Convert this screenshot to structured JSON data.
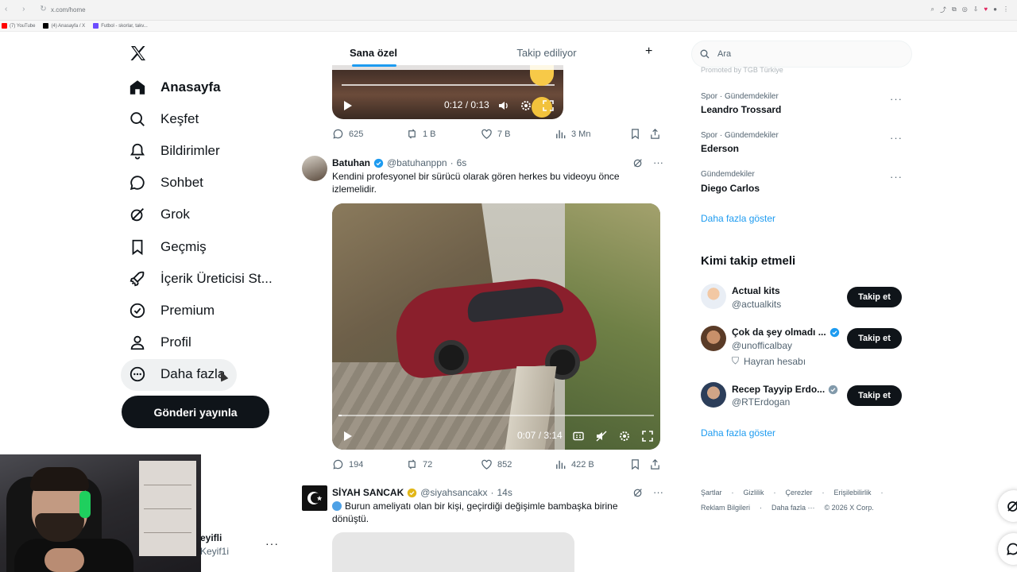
{
  "browser": {
    "url": "x.com/home",
    "bookmarks": [
      "(7) YouTube",
      "(4) Anasayfa / X",
      "Futbol - skorlar, takv..."
    ]
  },
  "sidebar": {
    "items": [
      {
        "label": "Anasayfa",
        "icon": "home-icon",
        "active": true
      },
      {
        "label": "Keşfet",
        "icon": "search-icon"
      },
      {
        "label": "Bildirimler",
        "icon": "bell-icon"
      },
      {
        "label": "Sohbet",
        "icon": "chat-icon"
      },
      {
        "label": "Grok",
        "icon": "grok-icon"
      },
      {
        "label": "Geçmiş",
        "icon": "bookmark-icon"
      },
      {
        "label": "İçerik Üreticisi St...",
        "icon": "rocket-icon"
      },
      {
        "label": "Premium",
        "icon": "verified-badge-icon"
      },
      {
        "label": "Profil",
        "icon": "person-icon"
      },
      {
        "label": "Daha fazla",
        "icon": "more-circle-icon"
      }
    ],
    "post_button": "Gönderi yayınla",
    "account": {
      "name": "eyifli",
      "handle": "Keyif1i"
    }
  },
  "timeline": {
    "tabs": [
      "Sana özel",
      "Takip ediliyor"
    ],
    "first_video": {
      "time": "0:12 / 0:13"
    },
    "first_actions": {
      "replies": "625",
      "reposts": "1 B",
      "likes": "7 B",
      "views": "3 Mn"
    },
    "tweet2": {
      "name": "Batuhan",
      "handle": "@batuhanppn",
      "time": "6s",
      "text": "Kendini profesyonel bir sürücü olarak gören herkes bu videoyu önce izlemelidir.",
      "video_time": "0:07 / 3:14",
      "replies": "194",
      "reposts": "72",
      "likes": "852",
      "views": "422 B"
    },
    "tweet3": {
      "name": "SİYAH SANCAK",
      "handle": "@siyahsancakx",
      "time": "14s",
      "text": "Burun ameliyatı olan bir kişi, geçirdiği değişimle bambaşka birine dönüştü."
    }
  },
  "right": {
    "search_placeholder": "Ara",
    "promoted": "Promoted by TGB Türkiye",
    "trends": [
      {
        "meta": "Spor · Gündemdekiler",
        "name": "Leandro Trossard"
      },
      {
        "meta": "Spor · Gündemdekiler",
        "name": "Ederson"
      },
      {
        "meta": "Gündemdekiler",
        "name": "Diego Carlos"
      }
    ],
    "show_more": "Daha fazla göster",
    "wtf_title": "Kimi takip etmeli",
    "wtf": [
      {
        "name": "Actual kits",
        "handle": "@actualkits",
        "verified": false,
        "extra": ""
      },
      {
        "name": "Çok da şey olmadı ...",
        "handle": "@unofficalbay",
        "verified": true,
        "extra": "Hayran hesabı"
      },
      {
        "name": "Recep Tayyip Erdo...",
        "handle": "@RTErdogan",
        "verified": true,
        "verified_color": "gray",
        "extra": ""
      }
    ],
    "follow_label": "Takip et",
    "show_more_2": "Daha fazla göster",
    "footer_row1": [
      "Şartlar",
      "Gizlilik",
      "Çerezler",
      "Erişilebilirlik"
    ],
    "footer_row2": [
      "Reklam Bilgileri",
      "Daha fazla ···",
      "© 2026 X Corp."
    ]
  },
  "colors": {
    "accent": "#1d9bf0",
    "text": "#0f1419",
    "muted": "#536471"
  }
}
